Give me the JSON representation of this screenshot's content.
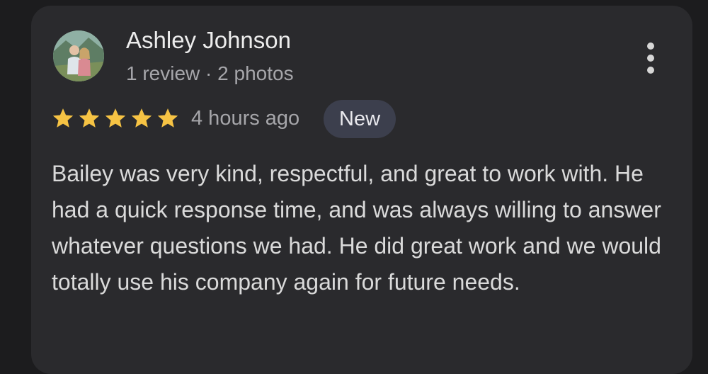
{
  "review": {
    "author_name": "Ashley Johnson",
    "author_meta": "1 review · 2 photos",
    "rating": 5,
    "rating_max": 5,
    "time_ago": "4 hours ago",
    "badge_label": "New",
    "text": "Bailey was very kind, respectful, and great to work with. He had a quick response time, and was always willing to answer whatever questions we had. He did great work and we would totally use his company again for future needs."
  },
  "icons": {
    "avatar": "avatar-photo",
    "menu": "more-vertical-icon",
    "star": "star-icon"
  },
  "colors": {
    "background": "#1c1c1e",
    "card": "#2a2a2d",
    "star": "#f6c344",
    "badge_bg": "#3c3f4d",
    "primary_text": "#ececec",
    "secondary_text": "#a6a6aa"
  }
}
